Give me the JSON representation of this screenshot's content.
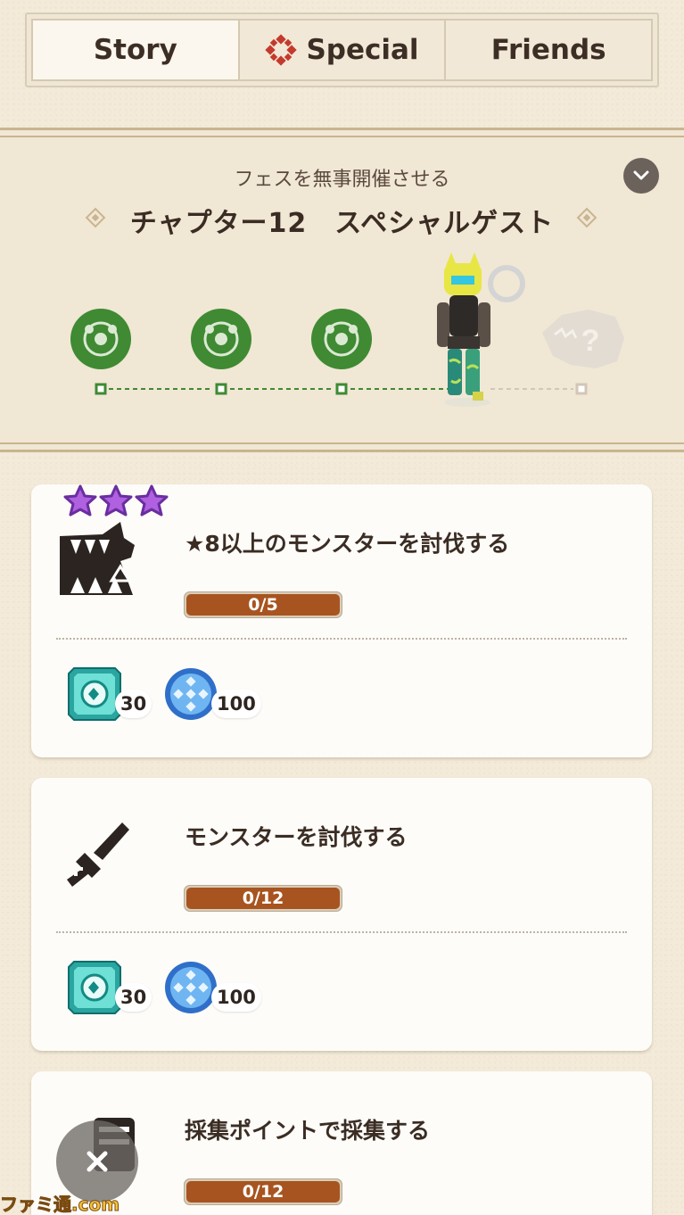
{
  "tabs": [
    {
      "label": "Story",
      "active": true
    },
    {
      "label": "Special",
      "icon": "special-emblem-icon",
      "active": false
    },
    {
      "label": "Friends",
      "active": false
    }
  ],
  "chapter": {
    "subtitle": "フェスを無事開催させる",
    "title": "チャプター12　スペシャルゲスト",
    "nodes": [
      {
        "state": "completed",
        "icon": "completed-node-icon"
      },
      {
        "state": "completed",
        "icon": "completed-node-icon"
      },
      {
        "state": "completed",
        "icon": "completed-node-icon"
      },
      {
        "state": "current",
        "icon": "hunter-avatar"
      },
      {
        "state": "locked",
        "icon": "locked-monster-icon"
      }
    ]
  },
  "missions": [
    {
      "title": "★8以上のモンスターを討伐する",
      "progress": "0/5",
      "stars": 3,
      "icon": "monster-jaw-icon",
      "rewards": [
        {
          "icon": "teal-gem-ticket-icon",
          "count": "30"
        },
        {
          "icon": "blue-medal-icon",
          "count": "100"
        }
      ]
    },
    {
      "title": "モンスターを討伐する",
      "progress": "0/12",
      "icon": "sword-icon",
      "rewards": [
        {
          "icon": "teal-gem-ticket-icon",
          "count": "30"
        },
        {
          "icon": "blue-medal-icon",
          "count": "100"
        }
      ]
    },
    {
      "title": "採集ポイントで採集する",
      "progress": "0/12",
      "icon": "gather-icon"
    }
  ],
  "watermark": "ファミ通.com",
  "colors": {
    "accent_green": "#3f8a33",
    "progress_fill": "#a85420",
    "background": "#f3ead9"
  }
}
